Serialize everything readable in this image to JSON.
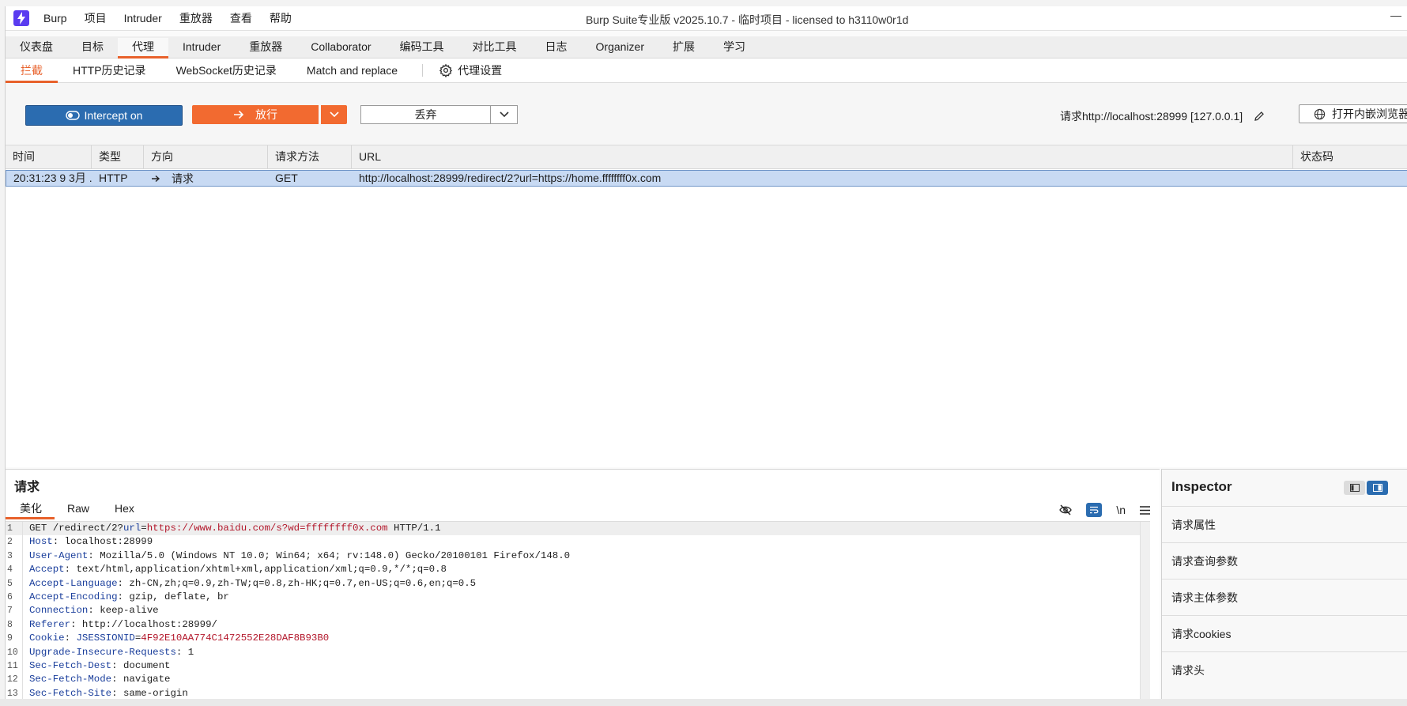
{
  "app": {
    "menu": [
      "Burp",
      "项目",
      "Intruder",
      "重放器",
      "查看",
      "帮助"
    ],
    "window_title": "Burp Suite专业版  v2025.10.7 - 临时项目 - licensed to h3110w0r1d"
  },
  "main_tabs": [
    "仪表盘",
    "目标",
    "代理",
    "Intruder",
    "重放器",
    "Collaborator",
    "编码工具",
    "对比工具",
    "日志",
    "Organizer",
    "扩展",
    "学习"
  ],
  "sub_tabs": [
    "拦截",
    "HTTP历史记录",
    "WebSocket历史记录",
    "Match and replace"
  ],
  "proxy_settings_label": "代理设置",
  "toolbar": {
    "intercept_label": "Intercept on",
    "forward_label": "放行",
    "drop_label": "丢弃",
    "request_info": "请求http://localhost:28999  [127.0.0.1]",
    "open_browser_label": "打开内嵌浏览器"
  },
  "table": {
    "headers": [
      "时间",
      "类型",
      "方向",
      "请求方法",
      "URL",
      "状态码"
    ],
    "rows": [
      {
        "time": "20:31:23 9 3月 ...",
        "type": "HTTP",
        "direction": "请求",
        "method": "GET",
        "url": "http://localhost:28999/redirect/2?url=https://home.ffffffff0x.com",
        "status": ""
      }
    ]
  },
  "request": {
    "title": "请求",
    "tabs": [
      "美化",
      "Raw",
      "Hex"
    ],
    "newline_label": "\\n",
    "lines": [
      {
        "n": "1",
        "parts": [
          {
            "t": "GET /redirect/2?",
            "c": ""
          },
          {
            "t": "url",
            "c": "blue"
          },
          {
            "t": "=",
            "c": ""
          },
          {
            "t": "https://www.baidu.com/s?wd=ffffffff0x.com",
            "c": "red"
          },
          {
            "t": " HTTP/1.1",
            "c": ""
          }
        ]
      },
      {
        "n": "2",
        "parts": [
          {
            "t": "Host",
            "c": "blue"
          },
          {
            "t": ": localhost:28999",
            "c": ""
          }
        ]
      },
      {
        "n": "3",
        "parts": [
          {
            "t": "User-Agent",
            "c": "blue"
          },
          {
            "t": ": Mozilla/5.0 (Windows NT 10.0; Win64; x64; rv:148.0) Gecko/20100101 Firefox/148.0",
            "c": ""
          }
        ]
      },
      {
        "n": "4",
        "parts": [
          {
            "t": "Accept",
            "c": "blue"
          },
          {
            "t": ": text/html,application/xhtml+xml,application/xml;q=0.9,*/*;q=0.8",
            "c": ""
          }
        ]
      },
      {
        "n": "5",
        "parts": [
          {
            "t": "Accept-Language",
            "c": "blue"
          },
          {
            "t": ": zh-CN,zh;q=0.9,zh-TW;q=0.8,zh-HK;q=0.7,en-US;q=0.6,en;q=0.5",
            "c": ""
          }
        ]
      },
      {
        "n": "6",
        "parts": [
          {
            "t": "Accept-Encoding",
            "c": "blue"
          },
          {
            "t": ": gzip, deflate, br",
            "c": ""
          }
        ]
      },
      {
        "n": "7",
        "parts": [
          {
            "t": "Connection",
            "c": "blue"
          },
          {
            "t": ": keep-alive",
            "c": ""
          }
        ]
      },
      {
        "n": "8",
        "parts": [
          {
            "t": "Referer",
            "c": "blue"
          },
          {
            "t": ": http://localhost:28999/",
            "c": ""
          }
        ]
      },
      {
        "n": "9",
        "parts": [
          {
            "t": "Cookie",
            "c": "blue"
          },
          {
            "t": ": ",
            "c": ""
          },
          {
            "t": "JSESSIONID",
            "c": "blue"
          },
          {
            "t": "=",
            "c": ""
          },
          {
            "t": "4F92E10AA774C1472552E28DAF8B93B0",
            "c": "red"
          }
        ]
      },
      {
        "n": "10",
        "parts": [
          {
            "t": "Upgrade-Insecure-Requests",
            "c": "blue"
          },
          {
            "t": ": 1",
            "c": ""
          }
        ]
      },
      {
        "n": "11",
        "parts": [
          {
            "t": "Sec-Fetch-Dest",
            "c": "blue"
          },
          {
            "t": ": document",
            "c": ""
          }
        ]
      },
      {
        "n": "12",
        "parts": [
          {
            "t": "Sec-Fetch-Mode",
            "c": "blue"
          },
          {
            "t": ": navigate",
            "c": ""
          }
        ]
      },
      {
        "n": "13",
        "parts": [
          {
            "t": "Sec-Fetch-Site",
            "c": "blue"
          },
          {
            "t": ": same-origin",
            "c": ""
          }
        ]
      }
    ]
  },
  "inspector": {
    "title": "Inspector",
    "items": [
      "请求属性",
      "请求查询参数",
      "请求主体参数",
      "请求cookies",
      "请求头"
    ]
  },
  "colors": {
    "accent": "#e8612b",
    "intercept_blue": "#2b6cb0",
    "selected_row": "#c8daf3",
    "syntax_key": "#1b3f9c",
    "syntax_value": "#b3172b"
  }
}
